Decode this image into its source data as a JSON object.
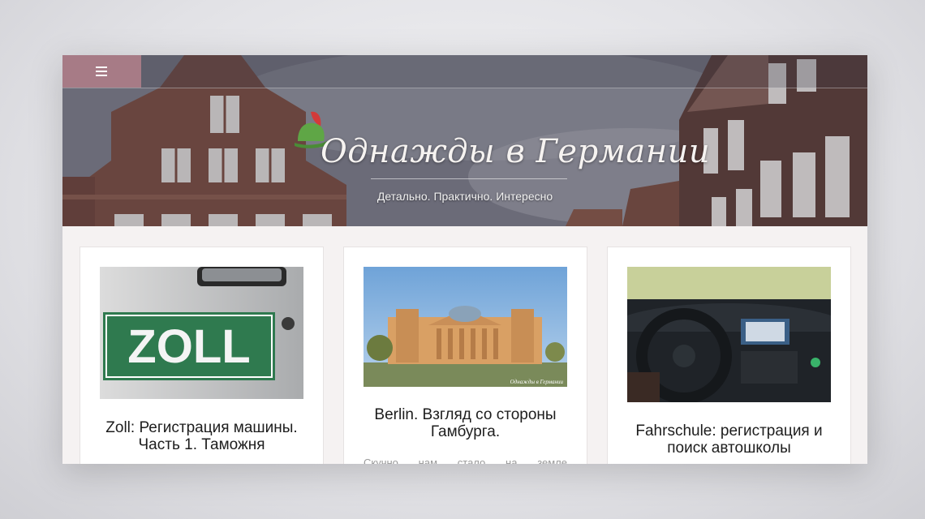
{
  "header": {
    "menu_icon": "hamburger-menu-icon",
    "site_title": "Однажды в Германии",
    "tagline": "Детально. Практично. Интересно"
  },
  "posts": [
    {
      "title": "Zoll: Регистрация машины. Часть 1. Таможня",
      "image_sign_text": "ZOLL"
    },
    {
      "title": "Berlin. Взгляд со стороны Гамбурга.",
      "excerpt": "Скучно нам стало на земле",
      "image_watermark": "Однажды в Германии"
    },
    {
      "title": "Fahrschule: регистрация и поиск автошколы"
    }
  ],
  "colors": {
    "menu_button": "#a77b86",
    "logo_hat_green": "#5fa646",
    "logo_feather_red": "#d23a3a",
    "sign_green": "#3d8a5a"
  }
}
